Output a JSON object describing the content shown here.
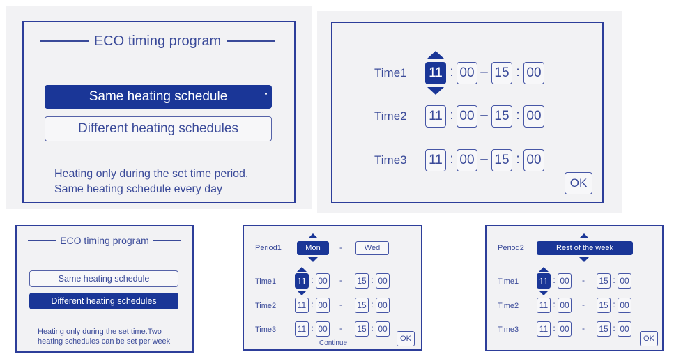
{
  "screen1": {
    "title": "ECO timing program",
    "options": [
      "Same heating schedule",
      "Different heating schedules"
    ],
    "description_lines": [
      "Heating only during the set time period.",
      "Same heating schedule every day"
    ]
  },
  "screen2": {
    "rows": [
      {
        "label": "Time1",
        "start_h": "11",
        "start_m": "00",
        "end_h": "15",
        "end_m": "00"
      },
      {
        "label": "Time2",
        "start_h": "11",
        "start_m": "00",
        "end_h": "15",
        "end_m": "00"
      },
      {
        "label": "Time3",
        "start_h": "11",
        "start_m": "00",
        "end_h": "15",
        "end_m": "00"
      }
    ],
    "colon": ":",
    "dash": "–",
    "ok_label": "OK"
  },
  "screen3": {
    "title": "ECO timing program",
    "options": [
      "Same heating schedule",
      "Different heating schedules"
    ],
    "description_lines": [
      "Heating only during the set time.Two",
      "heating schedules can be set per week"
    ]
  },
  "screen4": {
    "period_label": "Period1",
    "period_from": "Mon",
    "dash": "-",
    "period_to": "Wed",
    "rows": [
      {
        "label": "Time1",
        "start_h": "11",
        "start_m": "00",
        "end_h": "15",
        "end_m": "00"
      },
      {
        "label": "Time2",
        "start_h": "11",
        "start_m": "00",
        "end_h": "15",
        "end_m": "00"
      },
      {
        "label": "Time3",
        "start_h": "11",
        "start_m": "00",
        "end_h": "15",
        "end_m": "00"
      }
    ],
    "colon": ":",
    "continue_label": "Continue",
    "ok_label": "OK"
  },
  "screen5": {
    "period_label": "Period2",
    "period_value": "Rest of the week",
    "rows": [
      {
        "label": "Time1",
        "start_h": "11",
        "start_m": "00",
        "end_h": "15",
        "end_m": "00"
      },
      {
        "label": "Time2",
        "start_h": "11",
        "start_m": "00",
        "end_h": "15",
        "end_m": "00"
      },
      {
        "label": "Time3",
        "start_h": "11",
        "start_m": "00",
        "end_h": "15",
        "end_m": "00"
      }
    ],
    "colon": ":",
    "dash": "-",
    "ok_label": "OK"
  },
  "colors": {
    "border": "#2d3e9a",
    "selected": "#1a3697",
    "text": "#3a4a99",
    "background": "#f2f2f4"
  },
  "icons": [
    "arrow-up-icon",
    "arrow-down-icon"
  ]
}
